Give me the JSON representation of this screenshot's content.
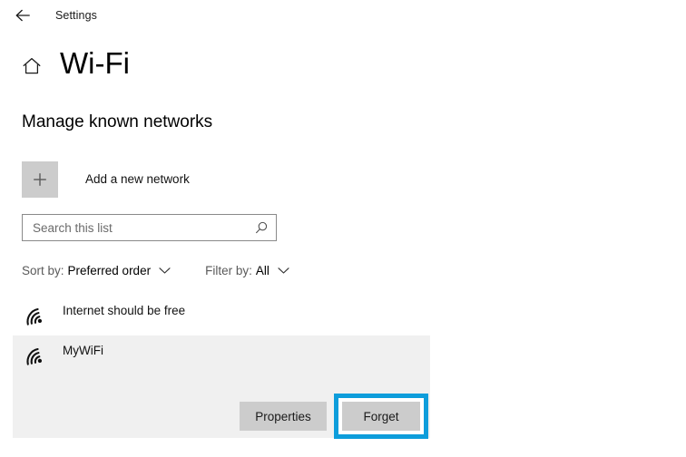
{
  "titlebar": {
    "back_icon": "back-arrow-icon",
    "title": "Settings"
  },
  "header": {
    "home_icon": "home-icon",
    "title": "Wi-Fi"
  },
  "main": {
    "section_heading": "Manage known networks",
    "add_network": {
      "icon": "plus-icon",
      "label": "Add a new network"
    },
    "search": {
      "placeholder": "Search this list",
      "value": "",
      "icon": "search-icon"
    },
    "sort": {
      "label": "Sort by:",
      "value": "Preferred order",
      "chevron": "chevron-down-icon"
    },
    "filter": {
      "label": "Filter by:",
      "value": "All",
      "chevron": "chevron-down-icon"
    },
    "networks": [
      {
        "name": "Internet should be free",
        "icon": "wifi-icon",
        "selected": false
      },
      {
        "name": "MyWiFi",
        "icon": "wifi-icon",
        "selected": true
      }
    ],
    "actions": {
      "properties_label": "Properties",
      "forget_label": "Forget"
    }
  },
  "colors": {
    "highlight": "#0d9ddb",
    "button_face": "#cccccc",
    "selected_row": "#f0f0f0",
    "page_background": "#ffffff",
    "text": "#000000",
    "muted_text": "#5a5a5a"
  }
}
